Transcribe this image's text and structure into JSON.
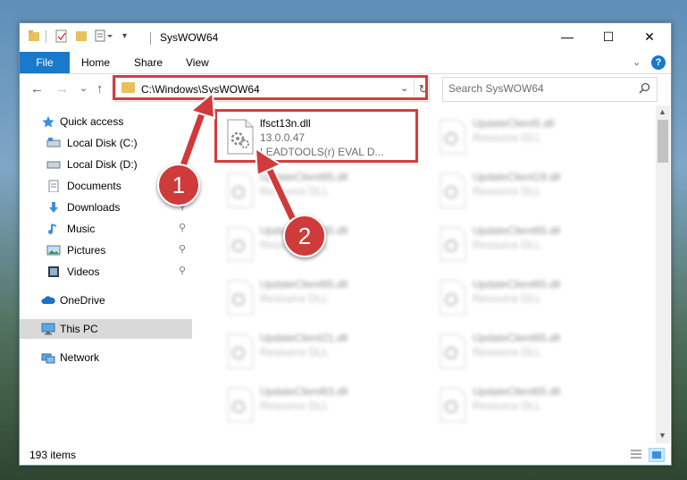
{
  "window": {
    "title": "SysWOW64",
    "minimize_glyph": "—",
    "maximize_glyph": "☐",
    "close_glyph": "✕"
  },
  "ribbon": {
    "tabs": [
      "File",
      "Home",
      "Share",
      "View"
    ],
    "help_glyph": "?",
    "collapse_glyph": "⌄"
  },
  "nav": {
    "back_glyph": "←",
    "forward_glyph": "→",
    "recent_glyph": "⌄",
    "up_glyph": "↑",
    "address": "C:\\Windows\\SysWOW64",
    "address_chevron": "⌄",
    "refresh_glyph": "↻",
    "search_placeholder": "Search SysWOW64"
  },
  "sidebar": {
    "items": [
      {
        "label": "Quick access",
        "icon": "star-icon",
        "pinned": false
      },
      {
        "label": "Local Disk (C:)",
        "icon": "drive-icon",
        "pinned": false
      },
      {
        "label": "Local Disk (D:)",
        "icon": "drive-icon",
        "pinned": false
      },
      {
        "label": "Documents",
        "icon": "documents-icon",
        "pinned": false
      },
      {
        "label": "Downloads",
        "icon": "download-icon",
        "pinned": true
      },
      {
        "label": "Music",
        "icon": "music-icon",
        "pinned": true
      },
      {
        "label": "Pictures",
        "icon": "pictures-icon",
        "pinned": true
      },
      {
        "label": "Videos",
        "icon": "videos-icon",
        "pinned": true
      },
      {
        "label": "OneDrive",
        "icon": "cloud-icon",
        "pinned": false
      },
      {
        "label": "This PC",
        "icon": "computer-icon",
        "pinned": false,
        "selected": true
      },
      {
        "label": "Network",
        "icon": "network-icon",
        "pinned": false
      }
    ],
    "pin_glyph": "📌"
  },
  "files": {
    "featured": {
      "name": "lfsct13n.dll",
      "version": "13.0.0.47",
      "description": "LEADTOOLS(r) EVAL D..."
    },
    "left_column": [
      {
        "name": "UpdateClient65.dll",
        "type": "Resource DLL"
      },
      {
        "name": "UpdateClient65.dll",
        "type": "Resource DLL"
      },
      {
        "name": "UpdateClient65.dll",
        "type": "Resource DLL"
      },
      {
        "name": "UpdateClient21.dll",
        "type": "Resource DLL"
      },
      {
        "name": "UpdateClient63.dll",
        "type": "Resource DLL"
      }
    ],
    "right_column": [
      {
        "name": "UpdateClient5.dll",
        "type": "Resource DLL"
      },
      {
        "name": "UpdateClient19.dll",
        "type": "Resource DLL"
      },
      {
        "name": "UpdateClient65.dll",
        "type": "Resource DLL"
      },
      {
        "name": "UpdateClient65.dll",
        "type": "Resource DLL"
      },
      {
        "name": "UpdateClient65.dll",
        "type": "Resource DLL"
      },
      {
        "name": "UpdateClient65.dll",
        "type": "Resource DLL"
      }
    ]
  },
  "status": {
    "item_count": "193 items"
  },
  "callouts": [
    "1",
    "2"
  ],
  "colors": {
    "accent": "#1979ca",
    "highlight": "#d43d3d"
  }
}
